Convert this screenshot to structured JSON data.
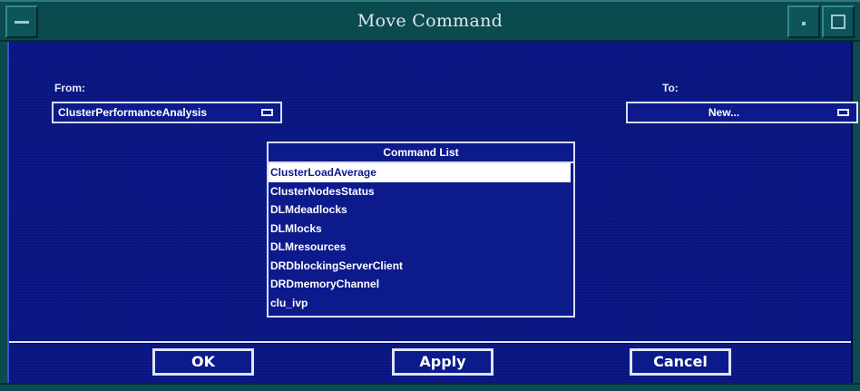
{
  "window": {
    "title": "Move Command"
  },
  "form": {
    "from_label": "From:",
    "from_value": "ClusterPerformanceAnalysis",
    "to_label": "To:",
    "to_value": "New..."
  },
  "command_list": {
    "header": "Command List",
    "items": [
      "ClusterLoadAverage",
      "ClusterNodesStatus",
      "DLMdeadlocks",
      "DLMlocks",
      "DLMresources",
      "DRDblockingServerClient",
      "DRDmemoryChannel",
      "clu_ivp"
    ],
    "selected": "ClusterLoadAverage"
  },
  "buttons": {
    "ok": "OK",
    "apply": "Apply",
    "cancel": "Cancel"
  },
  "colors": {
    "titlebar": "#0b4a4e",
    "body": "#0c1a8c",
    "text": "#ffffff"
  }
}
